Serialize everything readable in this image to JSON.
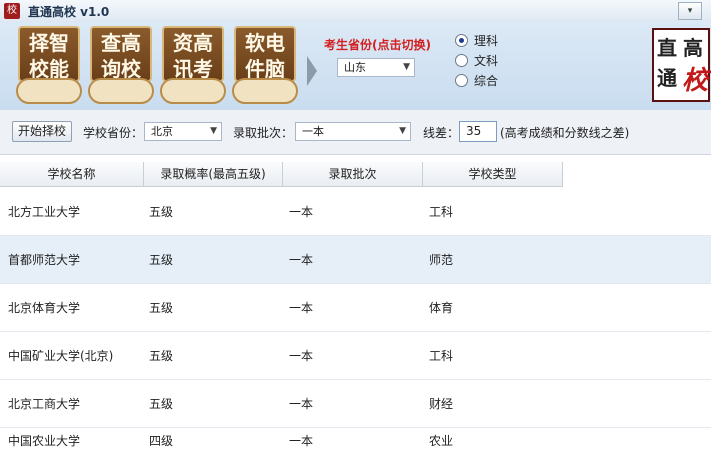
{
  "window": {
    "title": "直通高校 v1.0",
    "app_icon_glyph": "校",
    "restore_glyph": "▾"
  },
  "banner": {
    "features": [
      {
        "line1": "择智",
        "line2": "校能"
      },
      {
        "line1": "查高",
        "line2": "询校"
      },
      {
        "line1": "资高",
        "line2": "讯考"
      },
      {
        "line1": "软电",
        "line2": "件脑"
      }
    ],
    "province_label": "考生省份(点击切换)",
    "province_value": "山东",
    "subjects": [
      {
        "label": "理科",
        "selected": true
      },
      {
        "label": "文科",
        "selected": false
      },
      {
        "label": "综合",
        "selected": false
      }
    ],
    "logo": {
      "c1": "直",
      "c2": "通",
      "c3": "高",
      "c4": "校"
    }
  },
  "filter": {
    "start_button": "开始择校",
    "school_province_label": "学校省份：",
    "school_province_value": "北京",
    "batch_label": "录取批次：",
    "batch_value": "一本",
    "score_diff_label": "线差：",
    "score_diff_value": "35",
    "score_diff_note": "(高考成绩和分数线之差)"
  },
  "table": {
    "columns": [
      "学校名称",
      "录取概率(最高五级)",
      "录取批次",
      "学校类型"
    ],
    "rows": [
      [
        "北方工业大学",
        "五级",
        "一本",
        "工科"
      ],
      [
        "首都师范大学",
        "五级",
        "一本",
        "师范"
      ],
      [
        "北京体育大学",
        "五级",
        "一本",
        "体育"
      ],
      [
        "中国矿业大学(北京)",
        "五级",
        "一本",
        "工科"
      ],
      [
        "北京工商大学",
        "五级",
        "一本",
        "财经"
      ],
      [
        "中国农业大学",
        "四级",
        "一本",
        "农业"
      ]
    ]
  },
  "colors": {
    "accent_red": "#d22020",
    "selected_row": "#e6eff8"
  }
}
